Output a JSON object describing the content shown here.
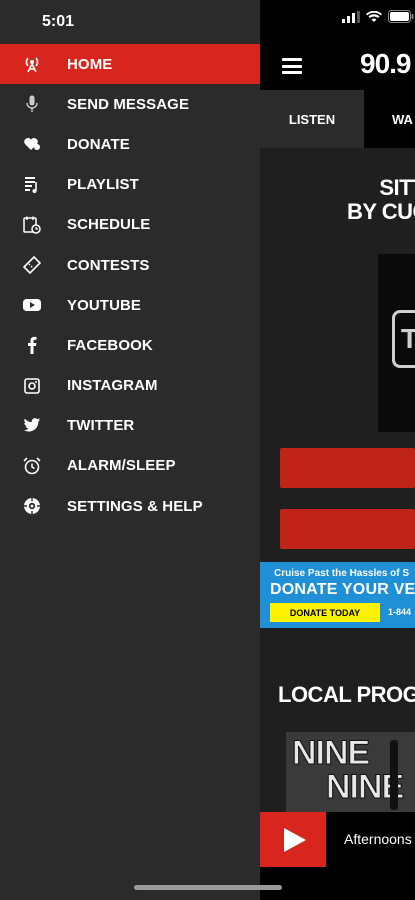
{
  "status_bar": {
    "time": "5:01"
  },
  "drawer": {
    "items": [
      {
        "label": "HOME",
        "icon": "radio-tower-icon",
        "active": true
      },
      {
        "label": "SEND MESSAGE",
        "icon": "microphone-icon"
      },
      {
        "label": "DONATE",
        "icon": "heart-hand-icon"
      },
      {
        "label": "PLAYLIST",
        "icon": "playlist-icon"
      },
      {
        "label": "SCHEDULE",
        "icon": "calendar-clock-icon"
      },
      {
        "label": "CONTESTS",
        "icon": "ticket-icon"
      },
      {
        "label": "YOUTUBE",
        "icon": "youtube-icon"
      },
      {
        "label": "FACEBOOK",
        "icon": "facebook-icon"
      },
      {
        "label": "INSTAGRAM",
        "icon": "instagram-icon"
      },
      {
        "label": "TWITTER",
        "icon": "twitter-icon"
      },
      {
        "label": "ALARM/SLEEP",
        "icon": "alarm-clock-icon"
      },
      {
        "label": "SETTINGS & HELP",
        "icon": "settings-help-icon"
      }
    ]
  },
  "main": {
    "station": "90.9",
    "tabs": [
      {
        "label": "LISTEN"
      },
      {
        "label": "WA"
      }
    ],
    "now_playing": {
      "line1": "SITTI",
      "line2": "BY CUCO F"
    },
    "artwork_badge": "T",
    "banner": {
      "top_text": "Cruise Past the Hassles of S",
      "main_text": "DONATE YOUR VE",
      "button_label": "DONATE TODAY",
      "phone": "1-844"
    },
    "section_title": "LOCAL PROGRAMS",
    "program_card": {
      "line1": "NINE",
      "line2": "NINE"
    },
    "player": {
      "text": "Afternoons"
    }
  },
  "colors": {
    "accent": "#d8251d",
    "drawer_bg": "#2b2b2b",
    "banner_bg": "#1f8fd6",
    "banner_button": "#fff200"
  }
}
